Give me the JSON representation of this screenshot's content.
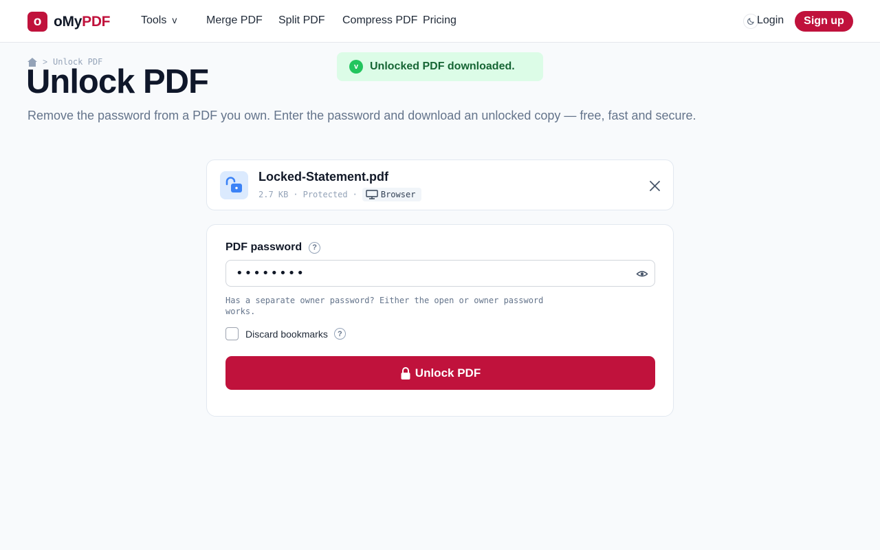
{
  "header": {
    "logo_badge": "o",
    "logo_prefix": "oMy",
    "logo_accent": "PDF",
    "nav": {
      "tools": "Tools",
      "tools_chevron": "v",
      "merge": "Merge PDF",
      "split": "Split PDF",
      "compress": "Compress PDF",
      "pricing": "Pricing"
    },
    "login": "Login",
    "signup": "Sign up"
  },
  "breadcrumb": {
    "separator": ">",
    "current": "Unlock PDF"
  },
  "page": {
    "title": "Unlock PDF",
    "subtitle": "Remove the password from a PDF you own. Enter the password and download an unlocked copy — free, fast and secure."
  },
  "toast": {
    "icon": "v",
    "message": "Unlocked PDF downloaded."
  },
  "file": {
    "name": "Locked-Statement.pdf",
    "size": "2.7 KB",
    "status": "Protected",
    "separator": "·",
    "source": "Browser"
  },
  "form": {
    "password_label": "PDF password",
    "help_glyph": "?",
    "password_value": "••••••••",
    "hint": "Has a separate owner password? Either the open or owner password works.",
    "discard_bookmarks_label": "Discard bookmarks",
    "discard_bookmarks_checked": false,
    "unlock_button": "Unlock PDF"
  },
  "colors": {
    "brand": "#c0123c",
    "toast_bg": "#dcfce7",
    "toast_text": "#166534",
    "success": "#22c55e"
  },
  "icons": {
    "home": "home-icon",
    "file": "unlocked-padlock-icon",
    "browser": "monitor-icon",
    "close": "close-icon",
    "eye": "eye-icon",
    "lock": "lock-icon",
    "theme": "moon-icon"
  }
}
